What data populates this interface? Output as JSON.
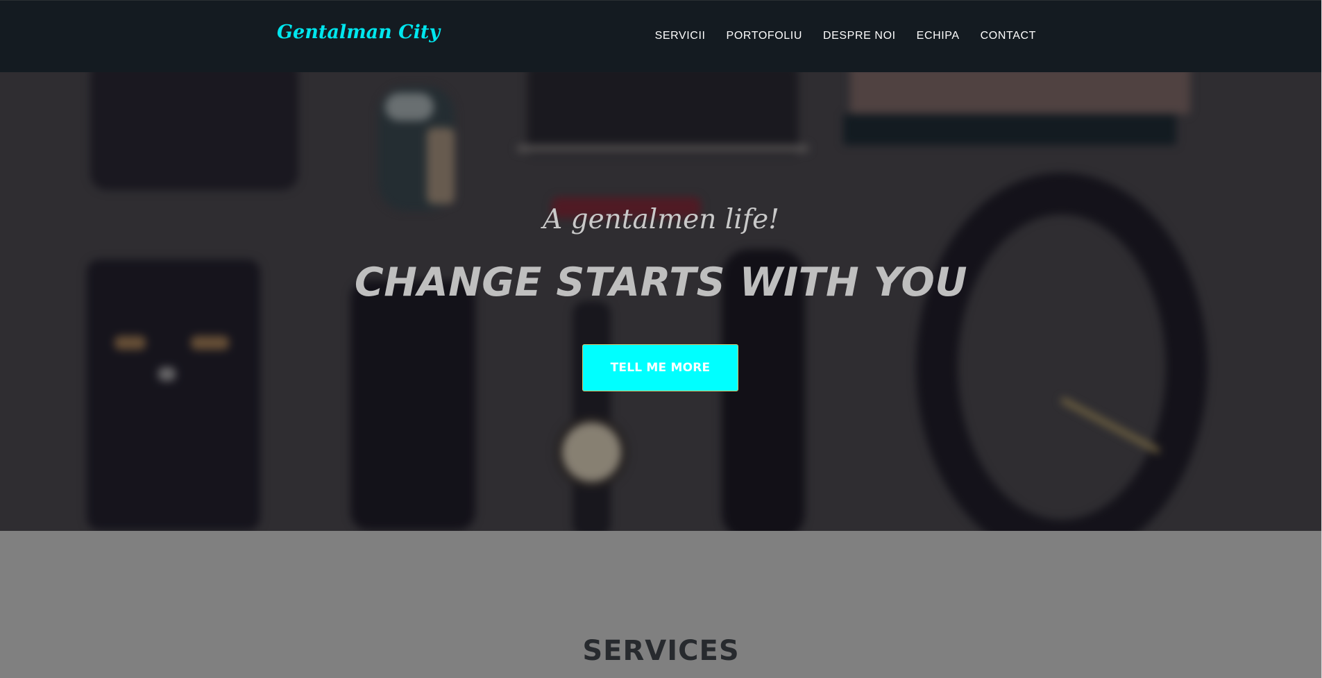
{
  "navbar": {
    "brand": "Gentalman City",
    "links": [
      "SERVICII",
      "PORTOFOLIU",
      "DESPRE NOI",
      "ECHIPA",
      "CONTACT"
    ]
  },
  "hero": {
    "subtitle": "A gentalmen life!",
    "title": "CHANGE STARTS WITH YOU",
    "button_label": "TELL ME MORE"
  },
  "services": {
    "title": "SERVICES"
  },
  "colors": {
    "accent": "#00ffff",
    "brand": "#00e6ee",
    "navbar_bg": "#141b21",
    "section_bg": "#808080"
  }
}
